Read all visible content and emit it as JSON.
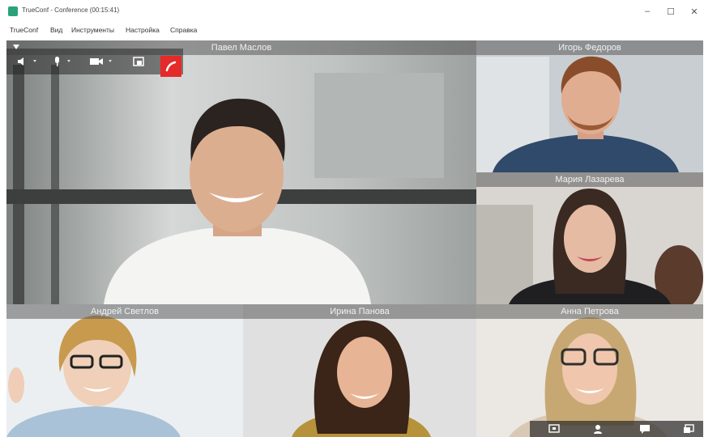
{
  "window": {
    "title": "TrueConf - Conference (00:15:41)",
    "minimize": "–",
    "maximize": "☐",
    "close": "✕"
  },
  "menu": [
    "TrueConf",
    "Вид",
    "Инструменты",
    "Настройка",
    "Справка"
  ],
  "participants": [
    {
      "name": "Павел Маслов"
    },
    {
      "name": "Игорь Федоров"
    },
    {
      "name": "Мария Лазарева"
    },
    {
      "name": "Андрей Светлов"
    },
    {
      "name": "Ирина Панова"
    },
    {
      "name": "Анна Петрова"
    }
  ],
  "toolbar": {
    "icons": [
      "speaker-icon",
      "microphone-icon",
      "camera-icon",
      "screen-share-icon",
      "hangup-icon"
    ]
  },
  "bottom_bar": {
    "icons": [
      "presentation-icon",
      "participants-icon",
      "chat-icon",
      "fullscreen-icon"
    ]
  },
  "colors": {
    "hangup": "#e52a2a",
    "app_icon": "#2aa37a"
  }
}
